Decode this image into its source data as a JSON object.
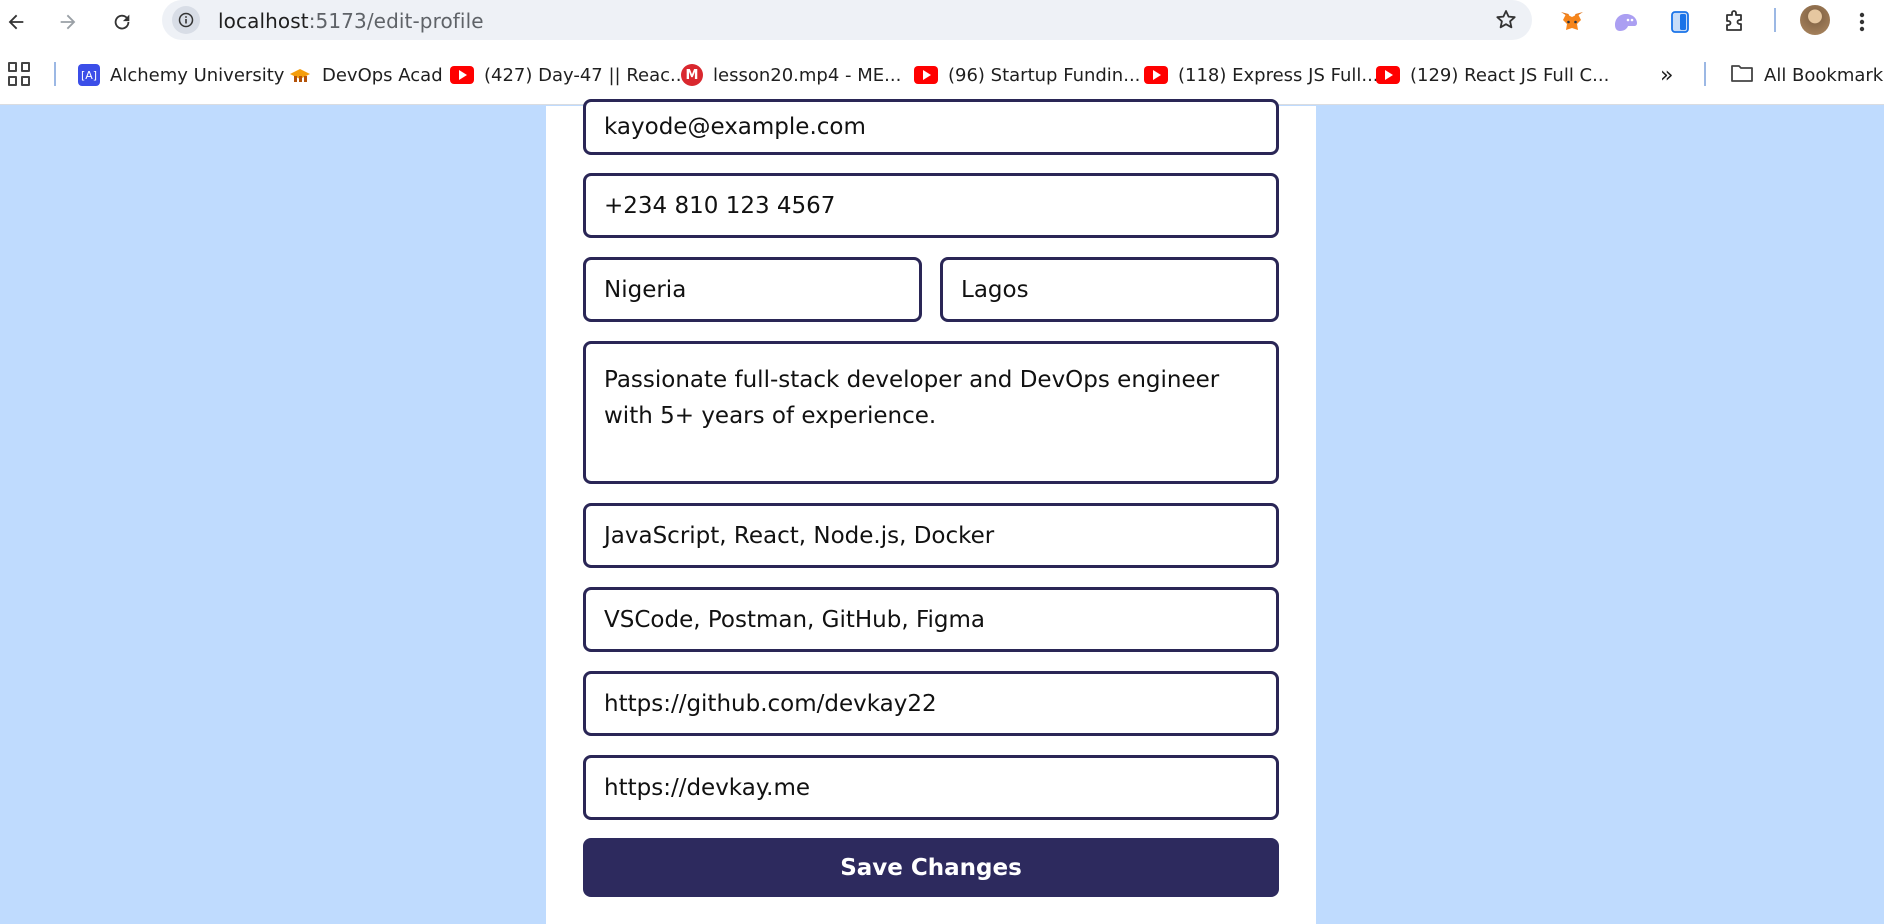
{
  "browser": {
    "url_host": "localhost",
    "url_path": ":5173/edit-profile"
  },
  "bookmarks": {
    "items": [
      {
        "label": "Alchemy University",
        "icon": "alchemy-icon"
      },
      {
        "label": "DevOps Acad",
        "icon": "devops-icon"
      },
      {
        "label": "(427) Day-47 || Reac...",
        "icon": "youtube-icon"
      },
      {
        "label": "lesson20.mp4 - ME...",
        "icon": "mega-icon"
      },
      {
        "label": "(96) Startup Fundin...",
        "icon": "youtube-icon"
      },
      {
        "label": "(118) Express JS Full...",
        "icon": "youtube-icon"
      },
      {
        "label": "(129) React JS Full C...",
        "icon": "youtube-icon"
      }
    ],
    "more": "»",
    "all_bookmarks": "All Bookmarks"
  },
  "form": {
    "email": "kayode@example.com",
    "phone": "+234 810 123 4567",
    "country": "Nigeria",
    "city": "Lagos",
    "bio": "Passionate full-stack developer and DevOps engineer with 5+ years of experience.",
    "skills": "JavaScript, React, Node.js, Docker",
    "tools": "VSCode, Postman, GitHub, Figma",
    "github": "https://github.com/devkay22",
    "website": "https://devkay.me",
    "save_label": "Save Changes"
  },
  "colors": {
    "page_bg": "#bfdbfe",
    "field_border": "#2a2656",
    "button_bg": "#2d2a5e"
  }
}
